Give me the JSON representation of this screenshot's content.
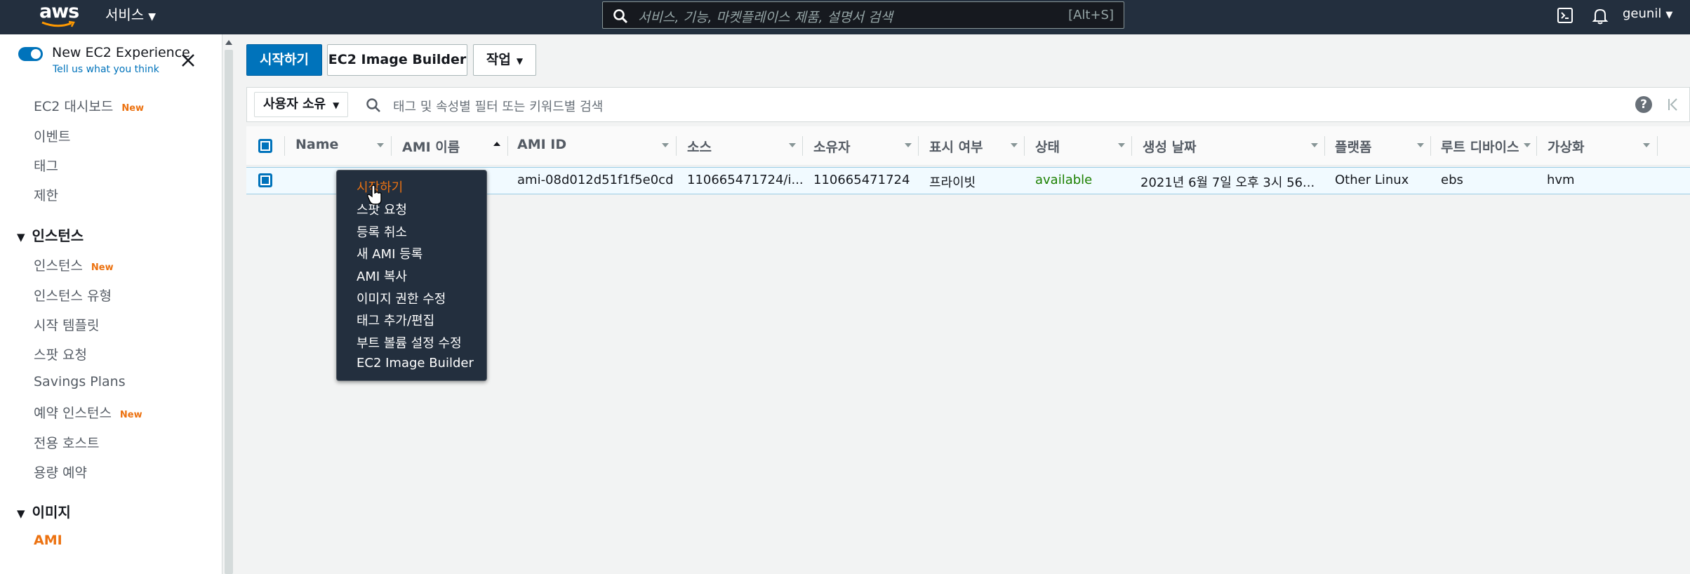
{
  "topbar": {
    "logo_text": "aws",
    "services_label": "서비스",
    "search_placeholder": "서비스, 기능, 마켓플레이스 제품, 설명서 검색",
    "search_shortcut": "[Alt+S]",
    "icons": [
      "terminal-icon",
      "bell-icon"
    ],
    "user_name": "geunil"
  },
  "sidebar": {
    "experience_title": "New EC2 Experience",
    "experience_sub": "Tell us what you think",
    "new_badge": "New",
    "items_top": [
      {
        "label": "EC2 대시보드",
        "new": true
      },
      {
        "label": "이벤트",
        "new": false
      },
      {
        "label": "태그",
        "new": false
      },
      {
        "label": "제한",
        "new": false
      }
    ],
    "section_instances": "인스턴스",
    "items_instances": [
      {
        "label": "인스턴스",
        "new": true
      },
      {
        "label": "인스턴스 유형",
        "new": false
      },
      {
        "label": "시작 템플릿",
        "new": false
      },
      {
        "label": "스팟 요청",
        "new": false
      },
      {
        "label": "Savings Plans",
        "new": false
      },
      {
        "label": "예약 인스턴스",
        "new": true
      },
      {
        "label": "전용 호스트",
        "new": false
      },
      {
        "label": "용량 예약",
        "new": false
      }
    ],
    "section_images": "이미지",
    "items_images": [
      {
        "label": "AMI",
        "active": true
      }
    ]
  },
  "toolbar": {
    "launch_label": "시작하기",
    "image_builder_label": "EC2 Image Builder",
    "actions_label": "작업"
  },
  "filter": {
    "owner_label": "사용자 소유",
    "search_placeholder": "태그 및 속성별 필터 또는 키워드별 검색"
  },
  "table": {
    "columns": [
      "Name",
      "AMI 이름",
      "AMI ID",
      "소스",
      "소유자",
      "표시 여부",
      "상태",
      "생성 날짜",
      "플랫폼",
      "루트 디바이스",
      "가상화"
    ],
    "rows": [
      {
        "name": "",
        "ami_name": "",
        "ami_id": "ami-08d012d51f1f5e0cd",
        "source": "110665471724/i...",
        "owner": "110665471724",
        "visibility": "프라이빗",
        "status": "available",
        "created": "2021년 6월 7일 오후 3시 56...",
        "platform": "Other Linux",
        "root_device": "ebs",
        "virtualization": "hvm"
      }
    ]
  },
  "context_menu": {
    "items": [
      "시작하기",
      "스팟 요청",
      "등록 취소",
      "새 AMI 등록",
      "AMI 복사",
      "이미지 권한 수정",
      "태그 추가/편집",
      "부트 볼륨 설정 수정",
      "EC2 Image Builder"
    ],
    "highlighted_index": 0
  },
  "colors": {
    "topbar_bg": "#232f3e",
    "accent_orange": "#ec7211",
    "primary_blue": "#0073bb",
    "status_green": "#1d8102"
  }
}
